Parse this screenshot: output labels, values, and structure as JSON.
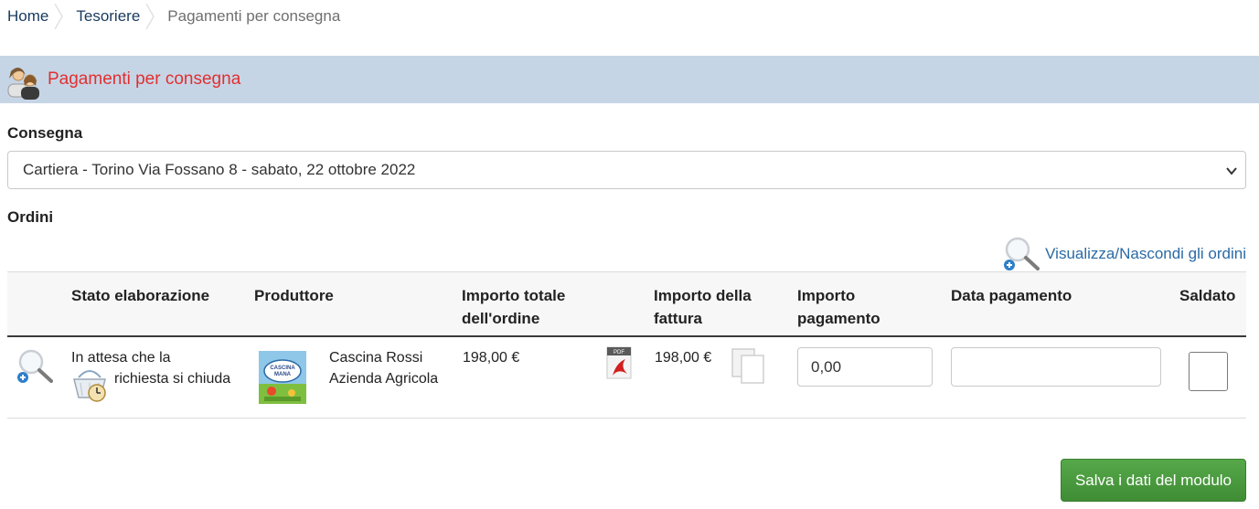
{
  "breadcrumb": {
    "home": "Home",
    "treasurer": "Tesoriere",
    "current": "Pagamenti per consegna"
  },
  "header": {
    "title": "Pagamenti per consegna",
    "icon": "users-icon"
  },
  "delivery": {
    "label": "Consegna",
    "selected": "Cartiera - Torino Via Fossano 8 - sabato, 22 ottobre 2022"
  },
  "orders": {
    "label": "Ordini",
    "toggle_link": "Visualizza/Nascondi gli ordini",
    "columns": {
      "stato": "Stato elaborazione",
      "produttore": "Produttore",
      "importo_totale": "Importo totale dell'ordine",
      "importo_fattura": "Importo della fattura",
      "importo_pagamento": "Importo pagamento",
      "data_pagamento": "Data pagamento",
      "saldato": "Saldato"
    },
    "rows": [
      {
        "stato": "In attesa che la richiesta si chiuda",
        "produttore_line1": "Cascina Rossi",
        "produttore_line2": "Azienda Agricola",
        "logo_text": "CASCINA MANA",
        "importo_totale": "198,00 €",
        "importo_fattura": "198,00 €",
        "importo_pagamento": "0,00",
        "data_pagamento": "",
        "saldato": false
      }
    ]
  },
  "actions": {
    "save": "Salva i dati del modulo"
  },
  "colors": {
    "header_band": "#c6d5e6",
    "title_red": "#e12f2f",
    "link_blue": "#2a6aa5",
    "save_green": "#4b9a3f"
  }
}
